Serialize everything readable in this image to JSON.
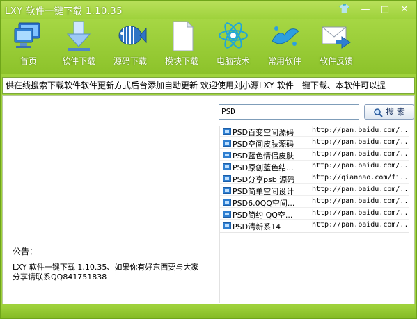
{
  "window": {
    "title": "LXY 软件一键下载 1.10.35",
    "buttons": {
      "skin": "👕",
      "minimize": "—",
      "maximize": "□",
      "close": "✕"
    }
  },
  "toolbar": {
    "items": [
      {
        "label": "首页",
        "icon": "monitor-icon"
      },
      {
        "label": "软件下载",
        "icon": "download-arrow-icon"
      },
      {
        "label": "源码下载",
        "icon": "fish-icon"
      },
      {
        "label": "模块下载",
        "icon": "document-icon"
      },
      {
        "label": "电脑技术",
        "icon": "atom-icon"
      },
      {
        "label": "常用软件",
        "icon": "splash-icon"
      },
      {
        "label": "软件反馈",
        "icon": "envelope-icon"
      }
    ]
  },
  "marquee": {
    "text": "供在线搜索下载软件软件更新方式后台添加自动更新 欢迎使用刘小源LXY 软件一键下载、本软件可以提"
  },
  "search": {
    "value": "PSD",
    "button_label": "搜 索"
  },
  "results": [
    {
      "name": "PSD百变空间源码",
      "url": "http://pan.baidu.com/..."
    },
    {
      "name": "PSD空间皮肤源码",
      "url": "http://pan.baidu.com/..."
    },
    {
      "name": "PSD蓝色情侣皮肤",
      "url": "http://pan.baidu.com/..."
    },
    {
      "name": "PSD原创蓝色结...",
      "url": "http://pan.baidu.com/..."
    },
    {
      "name": "PSD分享psb 源码",
      "url": "http://qiannao.com/fi..."
    },
    {
      "name": "PSD简单空间设计",
      "url": "http://pan.baidu.com/..."
    },
    {
      "name": "PSD6.0QQ空间...",
      "url": "http://pan.baidu.com/..."
    },
    {
      "name": "PSD简约 QQ空...",
      "url": "http://pan.baidu.com/..."
    },
    {
      "name": "PSD清新系14",
      "url": "http://pan.baidu.com/..."
    }
  ],
  "notice": {
    "title": "公告：",
    "line1": "LXY 软件一键下载 1.10.35、如果你有好东西要与大家",
    "line2": "分享请联系QQ841751838"
  },
  "colors": {
    "chrome_green": "#9fd23c",
    "accent_blue": "#2f7fd1"
  }
}
